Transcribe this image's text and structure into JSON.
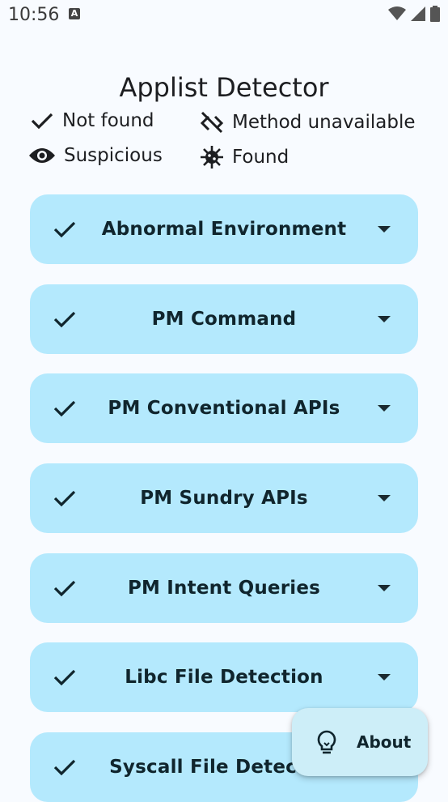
{
  "status_bar": {
    "time": "10:56",
    "notification_icon": "a-icon",
    "icons": [
      "wifi-icon",
      "signal-icon",
      "battery-icon"
    ]
  },
  "app": {
    "title": "Applist Detector"
  },
  "legend": {
    "not_found": "Not found",
    "method_unavailable": "Method unavailable",
    "suspicious": "Suspicious",
    "found": "Found"
  },
  "cards": [
    {
      "title": "Abnormal Environment",
      "status_icon": "check-icon"
    },
    {
      "title": "PM Command",
      "status_icon": "check-icon"
    },
    {
      "title": "PM Conventional APIs",
      "status_icon": "check-icon"
    },
    {
      "title": "PM Sundry APIs",
      "status_icon": "check-icon"
    },
    {
      "title": "PM Intent Queries",
      "status_icon": "check-icon"
    },
    {
      "title": "Libc File Detection",
      "status_icon": "check-icon"
    },
    {
      "title": "Syscall File Detection",
      "status_icon": "check-icon"
    }
  ],
  "fab": {
    "label": "About",
    "icon": "lightbulb-icon"
  },
  "colors": {
    "background": "#f8fbff",
    "card": "#b4e9fd",
    "fab": "#cdeef8",
    "text": "#1b1c1f"
  }
}
